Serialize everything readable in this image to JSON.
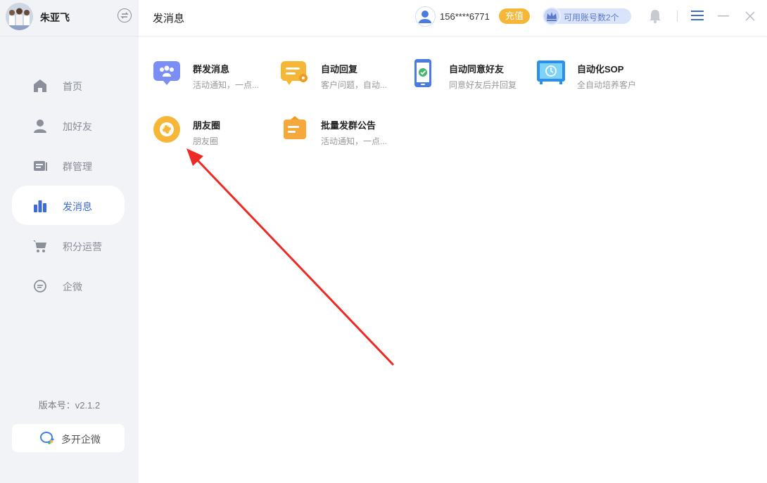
{
  "sidebar": {
    "username": "朱亚飞",
    "nav": [
      {
        "label": "首页"
      },
      {
        "label": "加好友"
      },
      {
        "label": "群管理"
      },
      {
        "label": "发消息"
      },
      {
        "label": "积分运营"
      },
      {
        "label": "企微"
      }
    ],
    "active_index": 3,
    "version": "版本号：v2.1.2",
    "multi_open_label": "多开企微"
  },
  "header": {
    "title": "发消息",
    "phone": "156****6771",
    "recharge_label": "充值",
    "accounts_label": "可用账号数2个"
  },
  "features": [
    {
      "title": "群发消息",
      "desc": "活动通知，一点...",
      "icon": "group-message-icon"
    },
    {
      "title": "自动回复",
      "desc": "客户问题，自动...",
      "icon": "auto-reply-icon"
    },
    {
      "title": "自动同意好友",
      "desc": "同意好友后并回复",
      "icon": "phone-check-icon"
    },
    {
      "title": "自动化SOP",
      "desc": "全自动培养客户",
      "icon": "monitor-sop-icon"
    },
    {
      "title": "朋友圈",
      "desc": "朋友圈",
      "icon": "moments-shutter-icon"
    },
    {
      "title": "批量发群公告",
      "desc": "活动通知，一点...",
      "icon": "group-notice-icon"
    }
  ],
  "colors": {
    "accent": "#3f6bd9",
    "orange": "#f6b739",
    "arrow": "#ee2a24",
    "sidebar_bg": "#f2f3f7"
  }
}
